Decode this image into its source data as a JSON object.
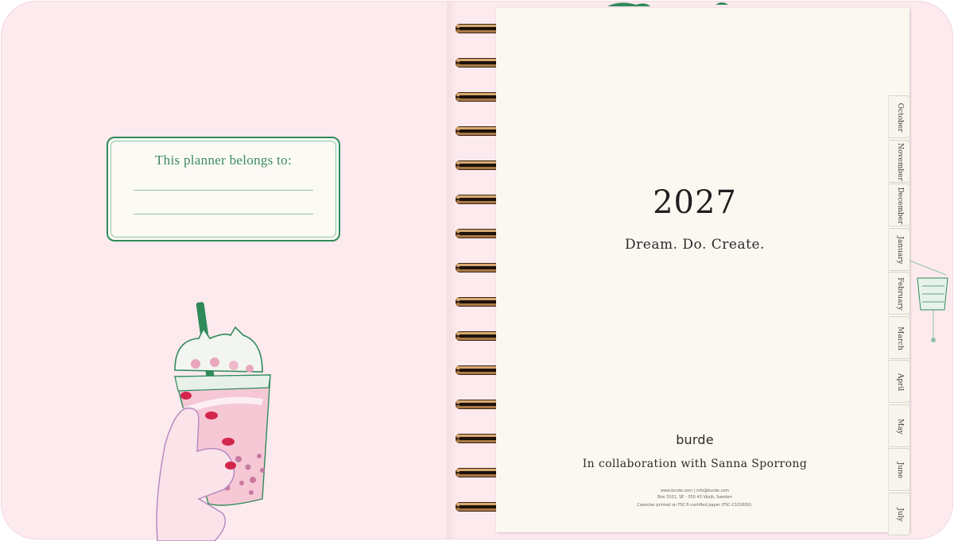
{
  "nameplate": {
    "title": "This planner belongs to:"
  },
  "page": {
    "year": "2027",
    "tagline": "Dream. Do. Create.",
    "brand": "burde",
    "collaboration": "In collaboration with Sanna Sporrong",
    "contact_line": "www.burde.com  |  info@burde.com",
    "address_line": "Box 3101, SE - 350 43 Växjö, Sweden",
    "paper_line": "Calendar printed on FSC®-certified paper (FSC-C102650)."
  },
  "tabs": [
    "October",
    "November",
    "December",
    "January",
    "February",
    "March",
    "April",
    "May",
    "June",
    "July"
  ],
  "colors": {
    "cover": "#fdeaee",
    "accent_green": "#2f8a5a",
    "page": "#fbf8f1",
    "ring_gold": "#b98a55"
  }
}
